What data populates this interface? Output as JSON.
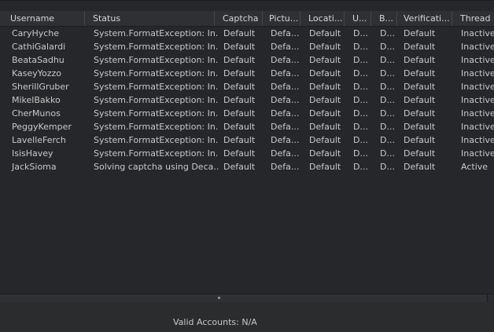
{
  "columns": [
    "Username",
    "Status",
    "Captcha",
    "Pictu...",
    "Locati...",
    "U...",
    "B...",
    "Verificati...",
    "Thread"
  ],
  "rows": [
    [
      "CaryHyche",
      "System.FormatException: In...",
      "Default",
      "Defa...",
      "Default",
      "D...",
      "D...",
      "Default",
      "Inactive"
    ],
    [
      "CathiGalardi",
      "System.FormatException: In...",
      "Default",
      "Defa...",
      "Default",
      "D...",
      "D...",
      "Default",
      "Inactive"
    ],
    [
      "BeataSadhu",
      "System.FormatException: In...",
      "Default",
      "Defa...",
      "Default",
      "D...",
      "D...",
      "Default",
      "Inactive"
    ],
    [
      "KaseyYozzo",
      "System.FormatException: In...",
      "Default",
      "Defa...",
      "Default",
      "D...",
      "D...",
      "Default",
      "Inactive"
    ],
    [
      "SherillGruber",
      "System.FormatException: In...",
      "Default",
      "Defa...",
      "Default",
      "D...",
      "D...",
      "Default",
      "Inactive"
    ],
    [
      "MikelBakko",
      "System.FormatException: In...",
      "Default",
      "Defa...",
      "Default",
      "D...",
      "D...",
      "Default",
      "Inactive"
    ],
    [
      "CherMunos",
      "System.FormatException: In...",
      "Default",
      "Defa...",
      "Default",
      "D...",
      "D...",
      "Default",
      "Inactive"
    ],
    [
      "PeggyKemper",
      "System.FormatException: In...",
      "Default",
      "Defa...",
      "Default",
      "D...",
      "D...",
      "Default",
      "Inactive"
    ],
    [
      "LavelleFerch",
      "System.FormatException: In...",
      "Default",
      "Defa...",
      "Default",
      "D...",
      "D...",
      "Default",
      "Inactive"
    ],
    [
      "IsisHavey",
      "System.FormatException: In...",
      "Default",
      "Defa...",
      "Default",
      "D...",
      "D...",
      "Default",
      "Inactive"
    ],
    [
      "JackSioma",
      "Solving captcha using Deca...",
      "Default",
      "Defa...",
      "Default",
      "D...",
      "D...",
      "Default",
      "Active"
    ]
  ],
  "status_bar": {
    "valid_accounts": "Valid Accounts: N/A"
  }
}
